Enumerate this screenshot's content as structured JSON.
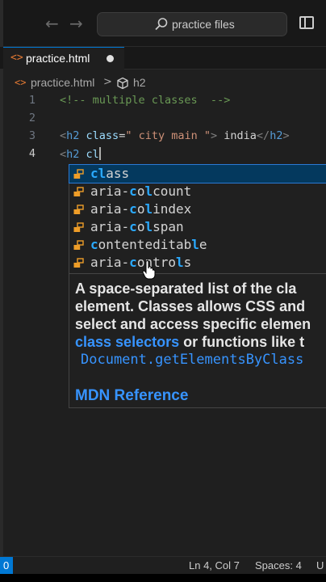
{
  "titlebar": {
    "back_arrow": "←",
    "forward_arrow": "→",
    "search_text": "practice files",
    "search_icon": "search-icon",
    "layout_icon": "toggle-sidebar-icon"
  },
  "tab": {
    "icon": "<>",
    "name": "practice.html",
    "unsaved_indicator": "●"
  },
  "breadcrumb": {
    "icon": "<>",
    "file": "practice.html",
    "separator": ">",
    "symbol_icon": "cube-icon",
    "symbol": "h2"
  },
  "editor": {
    "lines": [
      {
        "number": "1",
        "comment": "<!-- multiple classes  -->"
      },
      {
        "number": "2"
      },
      {
        "number": "3",
        "open": "<",
        "tag": "h2",
        "attr": "class",
        "eq": "=",
        "value": "\" city main \"",
        "close": ">",
        "text": " india",
        "end_open": "</",
        "end_tag": "h2",
        "end_close": ">"
      },
      {
        "number": "4",
        "open": "<",
        "tag": "h2",
        "typed": "cl"
      }
    ]
  },
  "suggestions": [
    {
      "hl1": "cl",
      "rest": "ass",
      "selected": true
    },
    {
      "pre": "aria-",
      "hl1": "c",
      "mid": "o",
      "hl2": "l",
      "rest": "count"
    },
    {
      "pre": "aria-",
      "hl1": "c",
      "mid": "o",
      "hl2": "l",
      "rest": "index"
    },
    {
      "pre": "aria-",
      "hl1": "c",
      "mid": "o",
      "hl2": "l",
      "rest": "span"
    },
    {
      "hl1": "c",
      "mid": "ontenteditab",
      "hl2": "l",
      "rest": "e"
    },
    {
      "pre": "aria-",
      "hl1": "c",
      "mid": "ontro",
      "hl2": "l",
      "rest": "s"
    }
  ],
  "docs": {
    "line1": "A space-separated list of the cla",
    "line2": "element. Classes allows CSS and",
    "line3": "select and access specific elemen",
    "line4_link": "class selectors",
    "line4_rest": " or functions like t",
    "code": "Document.getElementsByClass",
    "reference": "MDN Reference"
  },
  "statusbar": {
    "left": "0",
    "position": "Ln 4, Col 7",
    "spaces": "Spaces: 4",
    "encoding": "U"
  },
  "colors": {
    "accent": "#0078d4",
    "suggest_selected": "#04395e",
    "match_highlight": "#2aaaff",
    "link": "#3794ff"
  }
}
